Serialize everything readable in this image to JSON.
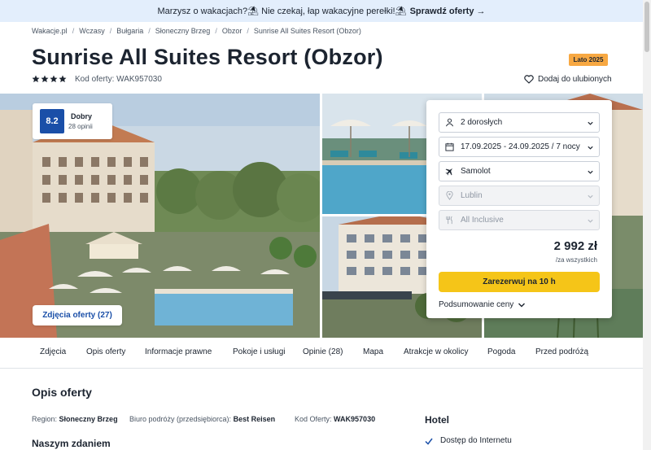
{
  "promo": {
    "text": "Marzysz o wakacjach?⛱ Nie czekaj, łap wakacyjne perełki!⛱",
    "cta": "Sprawdź oferty →"
  },
  "breadcrumb": [
    "Wakacje.pl",
    "Wczasy",
    "Bułgaria",
    "Słoneczny Brzeg",
    "Obzor",
    "Sunrise All Suites Resort (Obzor)"
  ],
  "hotel": {
    "title": "Sunrise All Suites Resort (Obzor)",
    "season_badge": "Lato 2025",
    "stars": 4,
    "offer_code": "Kod oferty: WAK957030",
    "favorite_label": "Dodaj do ulubionych"
  },
  "rating": {
    "score": "8.2",
    "label": "Dobry",
    "count": "28 opinii"
  },
  "gallery": {
    "photos_button": "Zdjęcia oferty (27)"
  },
  "booking": {
    "travelers": "2 dorosłych",
    "dates": "17.09.2025 - 24.09.2025 / 7 nocy",
    "transport": "Samolot",
    "departure": "Lublin",
    "board": "All Inclusive",
    "price": "2 992 zł",
    "price_note": "/za wszystkich",
    "book_button": "Zarezerwuj na 10 h",
    "summary_link": "Podsumowanie ceny"
  },
  "tabs": [
    "Zdjęcia",
    "Opis oferty",
    "Informacje prawne",
    "Pokoje i usługi",
    "Opinie (28)",
    "Mapa",
    "Atrakcje w okolicy",
    "Pogoda",
    "Przed podróżą"
  ],
  "description": {
    "title": "Opis oferty",
    "region_label": "Region:",
    "region_value": "Słoneczny Brzeg",
    "agency_label": "Biuro podróży (przedsiębiorca):",
    "agency_value": "Best Reisen",
    "code_label": "Kod Oferty:",
    "code_value": "WAK957030",
    "subheading": "Naszym zdaniem"
  },
  "hotel_features": {
    "heading": "Hotel",
    "items": [
      "Dostęp do Internetu"
    ]
  },
  "colors": {
    "accent_blue": "#1a4fa8",
    "book_yellow": "#f5c518",
    "season_orange": "#f7a842",
    "promo_bg": "#e3eefc"
  },
  "icons": [
    "star-icon",
    "heart-icon",
    "person-icon",
    "calendar-icon",
    "plane-icon",
    "location-icon",
    "utensils-icon",
    "chevron-down-icon",
    "check-icon"
  ]
}
